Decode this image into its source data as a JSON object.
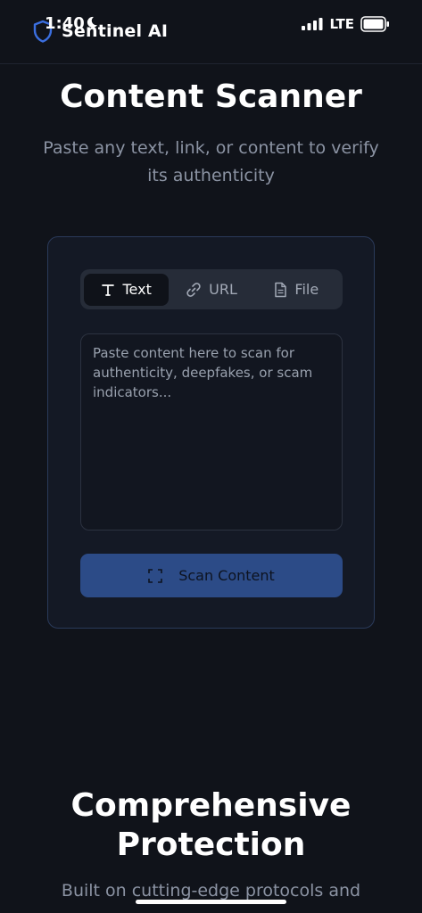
{
  "status_bar": {
    "time": "1:40",
    "network": "LTE"
  },
  "brand": {
    "name": "Sentinel AI",
    "accent_color": "#3b6fe0"
  },
  "hero": {
    "title": "Content Scanner",
    "subtitle": "Paste any text, link, or content to verify its authenticity"
  },
  "scanner": {
    "tabs": [
      {
        "label": "Text",
        "icon": "text-icon",
        "active": true
      },
      {
        "label": "URL",
        "icon": "link-icon",
        "active": false
      },
      {
        "label": "File",
        "icon": "file-icon",
        "active": false
      }
    ],
    "input": {
      "value": "",
      "placeholder": "Paste content here to scan for authenticity, deepfakes, or scam indicators..."
    },
    "scan_button_label": "Scan Content",
    "scan_button_icon": "scan-icon"
  },
  "features": {
    "title": "Comprehensive Protection",
    "subtitle": "Built on cutting-edge protocols and"
  }
}
